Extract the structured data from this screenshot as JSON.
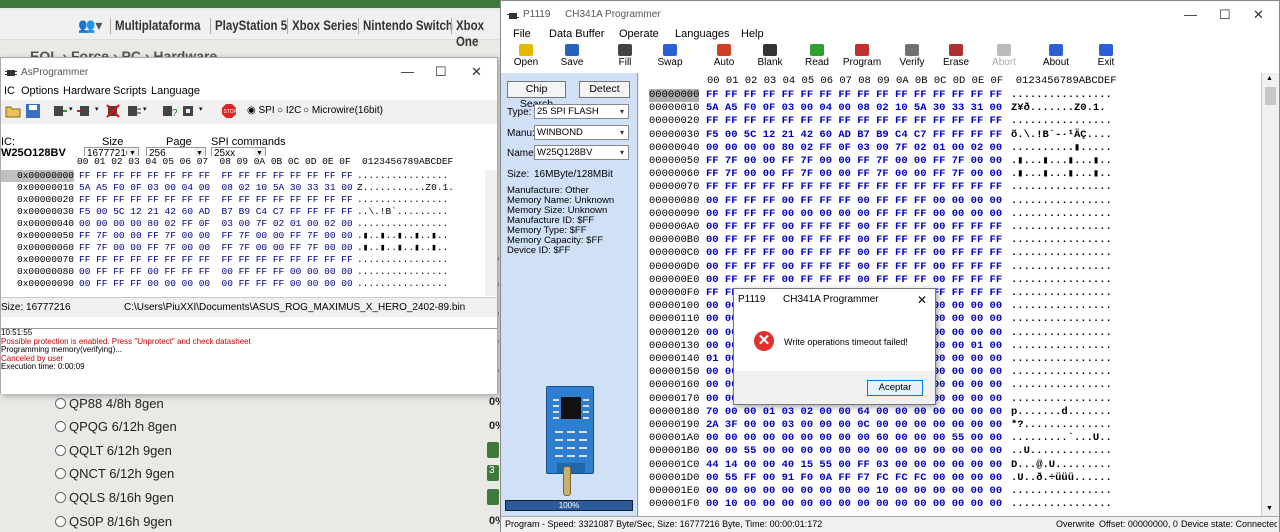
{
  "web": {
    "nav": [
      "Multiplataforma",
      "PlayStation 5",
      "Xbox Series",
      "Nintendo Switch",
      "Xbox One"
    ],
    "breadcrumb": "EOL  ›  Force  ›  PC  ›  Hardware",
    "options": [
      "QP88 4/8h 8gen",
      "QPQG 6/12h 8gen",
      "QQLT 6/12h 9gen",
      "QNCT 6/12h 9gen",
      "QQLS 8/16h 9gen",
      "QS0P 8/16h 9gen"
    ],
    "percents": [
      "%",
      "%",
      "%",
      "%",
      "%",
      "0%",
      "0%",
      "3",
      "0%"
    ]
  },
  "asp": {
    "title": "AsProgrammer",
    "menu": [
      "IC",
      "Options",
      "Hardware",
      "Scripts",
      "Language"
    ],
    "interfaces": [
      "SPI",
      "I2C",
      "Microwire(16bit)"
    ],
    "ic_label": "IC:",
    "ic_value": "W25Q128BV",
    "size_label": "Size",
    "size_value": "16777216",
    "page_label": "Page",
    "page_value": "256",
    "spi_label": "SPI commands",
    "spi_value": "25xx",
    "hex_header": "00 01 02 03 04 05 06 07  08 09 0A 0B 0C 0D 0E 0F  0123456789ABCDEF",
    "rows": [
      {
        "addr": "0x00000000",
        "bytes": "FF FF FF FF FF FF FF FF  FF FF FF FF FF FF FF FF",
        "ascii": "................"
      },
      {
        "addr": "0x00000010",
        "bytes": "5A A5 F0 0F 03 00 04 00  08 02 10 5A 30 33 31 00",
        "ascii": "Z...........Z0.1."
      },
      {
        "addr": "0x00000020",
        "bytes": "FF FF FF FF FF FF FF FF  FF FF FF FF FF FF FF FF",
        "ascii": "................"
      },
      {
        "addr": "0x00000030",
        "bytes": "F5 00 5C 12 21 42 60 AD  B7 B9 C4 C7 FF FF FF FF",
        "ascii": "..\\.!B`........."
      },
      {
        "addr": "0x00000040",
        "bytes": "00 00 00 00 80 02 FF 0F  03 00 7F 02 01 00 02 00",
        "ascii": "................"
      },
      {
        "addr": "0x00000050",
        "bytes": "FF 7F 00 00 FF 7F 00 00  FF 7F 00 00 FF 7F 00 00",
        "ascii": ".▮..▮..▮..▮..▮.."
      },
      {
        "addr": "0x00000060",
        "bytes": "FF 7F 00 00 FF 7F 00 00  FF 7F 00 00 FF 7F 00 00",
        "ascii": ".▮..▮..▮..▮..▮.."
      },
      {
        "addr": "0x00000070",
        "bytes": "FF FF FF FF FF FF FF FF  FF FF FF FF FF FF FF FF",
        "ascii": "................"
      },
      {
        "addr": "0x00000080",
        "bytes": "00 FF FF FF 00 FF FF FF  00 FF FF FF 00 00 00 00",
        "ascii": "................"
      },
      {
        "addr": "0x00000090",
        "bytes": "00 FF FF FF 00 00 00 00  00 FF FF FF 00 00 00 00",
        "ascii": "................"
      }
    ],
    "status_size": "Size: 16777216",
    "status_file": "C:\\Users\\PiuXXI\\Documents\\ASUS_ROG_MAXIMUS_X_HERO_2402-89.bin",
    "log": [
      {
        "text": "10:51:55",
        "red": false
      },
      {
        "text": "Possible protection is enabled. Press \"Unprotect\" and check datasheet",
        "red": true
      },
      {
        "text": "Programming memory(verifying)...",
        "red": false
      },
      {
        "text": "Canceled by user",
        "red": true
      },
      {
        "text": "Execution time: 0:00:09",
        "red": false
      }
    ]
  },
  "ch": {
    "title_left": "P1119",
    "title_right": "CH341A Programmer",
    "menu": [
      "File",
      "Data Buffer",
      "Operate",
      "Languages",
      "Help"
    ],
    "tools": [
      {
        "label": "Open",
        "icon": "folder-open-icon",
        "color": "#e6b800"
      },
      {
        "label": "Save",
        "icon": "floppy-disk-icon",
        "color": "#2563b8"
      },
      {
        "label": "Fill",
        "icon": "fill-icon",
        "color": "#444444"
      },
      {
        "label": "Swap",
        "icon": "swap-arrows-icon",
        "color": "#2a5fd6"
      },
      {
        "label": "Auto",
        "icon": "auto-icon",
        "color": "#d04020"
      },
      {
        "label": "Blank",
        "icon": "blank-check-icon",
        "color": "#333333"
      },
      {
        "label": "Read",
        "icon": "read-icon",
        "color": "#30a030"
      },
      {
        "label": "Program",
        "icon": "program-icon",
        "color": "#c03030"
      },
      {
        "label": "Verify",
        "icon": "verify-icon",
        "color": "#707070"
      },
      {
        "label": "Erase",
        "icon": "erase-icon",
        "color": "#b03030"
      },
      {
        "label": "Abort",
        "icon": "abort-icon",
        "color": "#bbbbbb"
      },
      {
        "label": "About",
        "icon": "about-icon",
        "color": "#2a5fd6"
      },
      {
        "label": "Exit",
        "icon": "exit-icon",
        "color": "#2a5fd6"
      }
    ],
    "chip_search": "Chip Search",
    "detect": "Detect",
    "type_label": "Type:",
    "type_value": "25 SPI FLASH",
    "manu_label": "Manu:",
    "manu_value": "WINBOND",
    "name_label": "Name:",
    "name_value": "W25Q128BV",
    "size_label": "Size:",
    "size_value": "16MByte/128MBit",
    "info": [
      "Manufacture: Other",
      "Memory Name: Unknown",
      "Memory Size: Unknown",
      "Manufacture ID: $FF",
      "Memory Type: $FF",
      "Memory Capacity: $FF",
      "Device ID: $FF"
    ],
    "progress": "100%",
    "hex_header": "00 01 02 03 04 05 06 07 08 09 0A 0B 0C 0D 0E 0F  0123456789ABCDEF",
    "rows": [
      {
        "addr": "00000000",
        "bytes": "FF FF FF FF FF FF FF FF FF FF FF FF FF FF FF FF",
        "ascii": "................"
      },
      {
        "addr": "00000010",
        "bytes": "5A A5 F0 0F 03 00 04 00 08 02 10 5A 30 33 31 00",
        "ascii": "Z¥ð.......Z0.1."
      },
      {
        "addr": "00000020",
        "bytes": "FF FF FF FF FF FF FF FF FF FF FF FF FF FF FF FF",
        "ascii": "................"
      },
      {
        "addr": "00000030",
        "bytes": "F5 00 5C 12 21 42 60 AD B7 B9 C4 C7 FF FF FF FF",
        "ascii": "õ.\\.!B`-·¹ÄÇ...."
      },
      {
        "addr": "00000040",
        "bytes": "00 00 00 00 80 02 FF 0F 03 00 7F 02 01 00 02 00",
        "ascii": "..........▮....."
      },
      {
        "addr": "00000050",
        "bytes": "FF 7F 00 00 FF 7F 00 00 FF 7F 00 00 FF 7F 00 00",
        "ascii": ".▮...▮...▮...▮.."
      },
      {
        "addr": "00000060",
        "bytes": "FF 7F 00 00 FF 7F 00 00 FF 7F 00 00 FF 7F 00 00",
        "ascii": ".▮...▮...▮...▮.."
      },
      {
        "addr": "00000070",
        "bytes": "FF FF FF FF FF FF FF FF FF FF FF FF FF FF FF FF",
        "ascii": "................"
      },
      {
        "addr": "00000080",
        "bytes": "00 FF FF FF 00 FF FF FF 00 FF FF FF 00 00 00 00",
        "ascii": "................"
      },
      {
        "addr": "00000090",
        "bytes": "00 FF FF FF 00 00 00 00 00 FF FF FF 00 00 00 00",
        "ascii": "................"
      },
      {
        "addr": "000000A0",
        "bytes": "00 FF FF FF 00 FF FF FF 00 FF FF FF 00 FF FF FF",
        "ascii": "................"
      },
      {
        "addr": "000000B0",
        "bytes": "00 FF FF FF 00 FF FF FF 00 FF FF FF 00 FF FF FF",
        "ascii": "................"
      },
      {
        "addr": "000000C0",
        "bytes": "00 FF FF FF 00 FF FF FF 00 FF FF FF 00 FF FF FF",
        "ascii": "................"
      },
      {
        "addr": "000000D0",
        "bytes": "00 FF FF FF 00 FF FF FF 00 FF FF FF 00 FF FF FF",
        "ascii": "................"
      },
      {
        "addr": "000000E0",
        "bytes": "00 FF FF FF 00 FF FF FF 00 FF FF FF 00 FF FF FF",
        "ascii": "................"
      },
      {
        "addr": "000000F0",
        "bytes": "FF FF FF FF FF FF FF FF FF FF FF FF FF FF FF FF",
        "ascii": "................"
      },
      {
        "addr": "00000100",
        "bytes": "00 00 00 00 00 00 00 00 00 00 00 00 00 00 00 00",
        "ascii": "................"
      },
      {
        "addr": "00000110",
        "bytes": "00 00 00 00 00 00 00 00 00 00 00 00 00 00 00 00",
        "ascii": "................"
      },
      {
        "addr": "00000120",
        "bytes": "00 00 00 00 00 00 00 00 00 00 00 00 00 00 00 00",
        "ascii": "................"
      },
      {
        "addr": "00000130",
        "bytes": "00 00 00 00 00 00 00 00 00 00 00 00 00 00 01 00",
        "ascii": "................"
      },
      {
        "addr": "00000140",
        "bytes": "01 00 00 00 00 00 00 00 00 00 00 00 00 00 00 00",
        "ascii": "................"
      },
      {
        "addr": "00000150",
        "bytes": "00 00 00 00 00 00 00 00 00 00 00 00 00 00 00 00",
        "ascii": "................"
      },
      {
        "addr": "00000160",
        "bytes": "00 00 00 00 00 00 00 00 00 00 00 00 00 00 00 00",
        "ascii": "................"
      },
      {
        "addr": "00000170",
        "bytes": "00 00 00 00 00 00 00 00 00 00 00 00 00 00 00 00",
        "ascii": "................"
      },
      {
        "addr": "00000180",
        "bytes": "70 00 00 01 03 02 00 00 64 00 00 00 00 00 00 00",
        "ascii": "p.......d......."
      },
      {
        "addr": "00000190",
        "bytes": "2A 3F 00 00 03 00 00 00 0C 00 00 00 00 00 00 00",
        "ascii": "*?.............."
      },
      {
        "addr": "000001A0",
        "bytes": "00 00 00 00 00 00 00 00 00 60 00 00 00 55 00 00",
        "ascii": ".........`...U.."
      },
      {
        "addr": "000001B0",
        "bytes": "00 00 55 00 00 00 00 00 00 00 00 00 00 00 00 00",
        "ascii": "..U............."
      },
      {
        "addr": "000001C0",
        "bytes": "44 14 00 00 40 15 55 00 FF 03 00 00 00 00 00 00",
        "ascii": "D...@.U........."
      },
      {
        "addr": "000001D0",
        "bytes": "00 55 FF 00 91 F0 0A FF F7 FC FC FC 00 00 00 00",
        "ascii": ".U..ð.÷üüü......"
      },
      {
        "addr": "000001E0",
        "bytes": "00 00 00 00 00 00 00 00 00 10 00 00 00 00 00 00",
        "ascii": "................"
      },
      {
        "addr": "000001F0",
        "bytes": "00 10 00 00 00 00 00 00 00 00 00 00 00 00 00 00",
        "ascii": "................"
      }
    ],
    "status": "Program - Speed: 3321087 Byte/Sec, Size: 16777216 Byte, Time: 00:00:01:172",
    "overwrite": "Overwrite",
    "offset": "Offset: 00000000, 0",
    "device_state": "Device state: Connected"
  },
  "dialog": {
    "title_left": "P1119",
    "title_right": "CH341A Programmer",
    "message": "Write operations timeout failed!",
    "ok": "Aceptar"
  }
}
